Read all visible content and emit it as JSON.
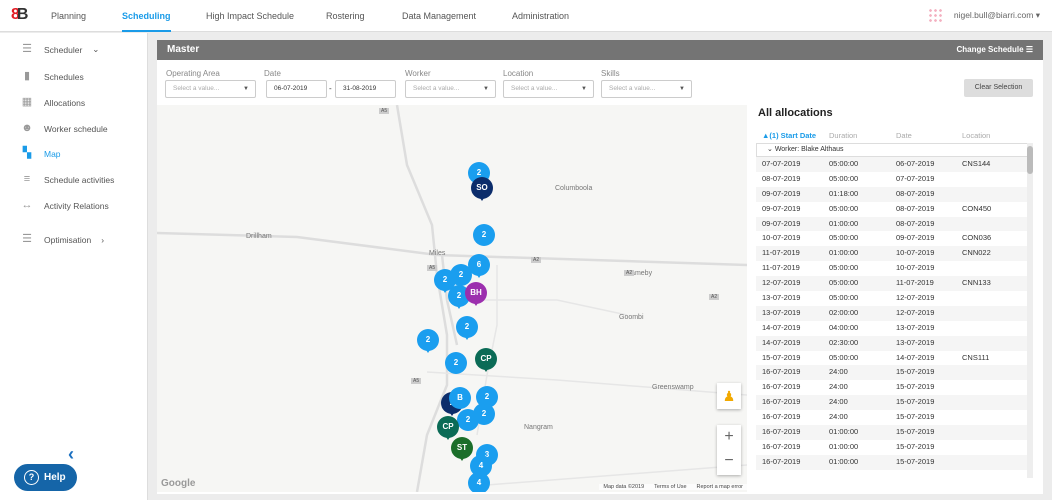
{
  "nav": {
    "logo": "8B",
    "items": [
      "Planning",
      "Scheduling",
      "High Impact Schedule",
      "Rostering",
      "Data Management",
      "Administration"
    ],
    "active": "Scheduling",
    "user": "nigel.bull@biarri.com"
  },
  "sidebar": {
    "scheduler": "Scheduler",
    "items": [
      "Schedules",
      "Allocations",
      "Worker schedule",
      "Map",
      "Schedule activities",
      "Activity Relations"
    ],
    "active": "Map",
    "optimisation": "Optimisation",
    "help": "Help"
  },
  "panel": {
    "title": "Master",
    "change_schedule": "Change Schedule",
    "filters": {
      "operating_area": "Operating Area",
      "date": "Date",
      "worker": "Worker",
      "location": "Location",
      "skills": "Skills",
      "placeholder": "Select a value...",
      "date_from": "06-07-2019",
      "date_to": "31-08-2019",
      "date_sep": "-",
      "clear": "Clear Selection"
    }
  },
  "map": {
    "labels": [
      "Columboola",
      "Drillham",
      "Miles",
      "Cameby",
      "Goombi",
      "Greenswamp",
      "Nangram",
      "A2",
      "A2",
      "A2",
      "A5",
      "A5",
      "A5"
    ],
    "markers": [
      "2",
      "SO",
      "2",
      "6",
      "2",
      "2",
      "2",
      "BH",
      "2",
      "2",
      "2",
      "CP",
      "2",
      "B",
      "2",
      "2",
      "2",
      "CP",
      "ST",
      "3",
      "4",
      "4"
    ],
    "attribution": [
      "Map data ©2019",
      "Terms of Use",
      "Report a map error"
    ],
    "google": "Google",
    "zoom_in": "+",
    "zoom_out": "−"
  },
  "allocations": {
    "title": "All allocations",
    "headers": [
      "▲(1) Start Date",
      "Duration",
      "Date",
      "Location"
    ],
    "group": "Worker: Blake Althaus",
    "rows": [
      [
        "07-07-2019",
        "05:00:00",
        "06-07-2019",
        "CNS144"
      ],
      [
        "08-07-2019",
        "05:00:00",
        "07-07-2019",
        ""
      ],
      [
        "09-07-2019",
        "01:18:00",
        "08-07-2019",
        ""
      ],
      [
        "09-07-2019",
        "05:00:00",
        "08-07-2019",
        "CON450"
      ],
      [
        "09-07-2019",
        "01:00:00",
        "08-07-2019",
        ""
      ],
      [
        "10-07-2019",
        "05:00:00",
        "09-07-2019",
        "CON036"
      ],
      [
        "11-07-2019",
        "01:00:00",
        "10-07-2019",
        "CNN022"
      ],
      [
        "11-07-2019",
        "05:00:00",
        "10-07-2019",
        ""
      ],
      [
        "12-07-2019",
        "05:00:00",
        "11-07-2019",
        "CNN133"
      ],
      [
        "13-07-2019",
        "05:00:00",
        "12-07-2019",
        ""
      ],
      [
        "13-07-2019",
        "02:00:00",
        "12-07-2019",
        ""
      ],
      [
        "14-07-2019",
        "04:00:00",
        "13-07-2019",
        ""
      ],
      [
        "14-07-2019",
        "02:30:00",
        "13-07-2019",
        ""
      ],
      [
        "15-07-2019",
        "05:00:00",
        "14-07-2019",
        "CNS111"
      ],
      [
        "16-07-2019",
        "24:00",
        "15-07-2019",
        ""
      ],
      [
        "16-07-2019",
        "24:00",
        "15-07-2019",
        ""
      ],
      [
        "16-07-2019",
        "24:00",
        "15-07-2019",
        ""
      ],
      [
        "16-07-2019",
        "24:00",
        "15-07-2019",
        ""
      ],
      [
        "16-07-2019",
        "01:00:00",
        "15-07-2019",
        ""
      ],
      [
        "16-07-2019",
        "01:00:00",
        "15-07-2019",
        ""
      ],
      [
        "16-07-2019",
        "01:00:00",
        "15-07-2019",
        ""
      ]
    ]
  }
}
